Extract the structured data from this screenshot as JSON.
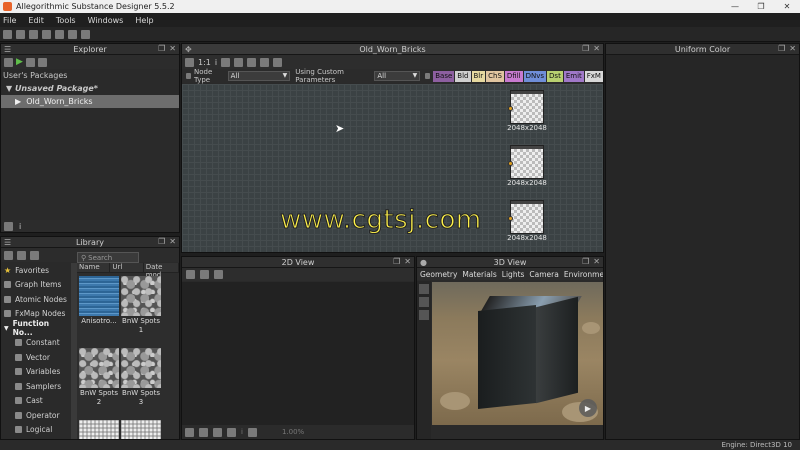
{
  "window": {
    "title": "Allegorithmic Substance Designer 5.5.2",
    "minimize": "—",
    "restore": "❐",
    "close": "✕"
  },
  "menu": [
    "File",
    "Edit",
    "Tools",
    "Windows",
    "Help"
  ],
  "explorer": {
    "title": "Explorer",
    "section": "User's Packages",
    "package": "Unsaved Package*",
    "graph_item": "Old_Worn_Bricks"
  },
  "graph": {
    "title": "Old_Worn_Bricks",
    "zoom_label": "1:1",
    "node_type_label": "Node Type",
    "node_type_value": "All",
    "custom_params_label": "Using Custom Parameters",
    "custom_params_value": "All",
    "tags": [
      {
        "label": "Base",
        "color": "#8d5fa0"
      },
      {
        "label": "Bld",
        "color": "#cfcfcf"
      },
      {
        "label": "Blr",
        "color": "#e6d9a0"
      },
      {
        "label": "ChS",
        "color": "#e0c5a0"
      },
      {
        "label": "Dfill",
        "color": "#c87ad0"
      },
      {
        "label": "DNvs",
        "color": "#6f8ed8"
      },
      {
        "label": "Dst",
        "color": "#b8d070"
      },
      {
        "label": "Emit",
        "color": "#a078c8"
      },
      {
        "label": "FxM",
        "color": "#d8d8d8"
      }
    ],
    "nodes": [
      {
        "label": "2048x2048"
      },
      {
        "label": "2048x2048"
      },
      {
        "label": "2048x2048"
      }
    ],
    "watermark": "www.cgtsj.com"
  },
  "uniform": {
    "title": "Uniform Color"
  },
  "library": {
    "title": "Library",
    "search_placeholder": "Search",
    "columns": [
      "Name",
      "Url",
      "Date mod"
    ],
    "categories": [
      {
        "label": "Favorites",
        "style": "star"
      },
      {
        "label": "Graph Items",
        "style": "normal"
      },
      {
        "label": "Atomic Nodes",
        "style": "normal"
      },
      {
        "label": "FxMap Nodes",
        "style": "normal"
      },
      {
        "label": "Function No...",
        "style": "bold"
      },
      {
        "label": "Constant",
        "style": "sub"
      },
      {
        "label": "Vector",
        "style": "sub"
      },
      {
        "label": "Variables",
        "style": "sub"
      },
      {
        "label": "Samplers",
        "style": "sub"
      },
      {
        "label": "Cast",
        "style": "sub"
      },
      {
        "label": "Operator",
        "style": "sub"
      },
      {
        "label": "Logical",
        "style": "sub"
      }
    ],
    "thumbnails": [
      {
        "label": "Anisotro...",
        "tex": "blue"
      },
      {
        "label": "BnW Spots 1",
        "tex": "spots"
      },
      {
        "label": "BnW Spots 2",
        "tex": "spots"
      },
      {
        "label": "BnW Spots 3",
        "tex": "spots"
      },
      {
        "label": "",
        "tex": "noise"
      },
      {
        "label": "",
        "tex": "noise"
      }
    ]
  },
  "view2d": {
    "title": "2D View",
    "zoom": "1.00%"
  },
  "view3d": {
    "title": "3D View",
    "menu": [
      "Geometry",
      "Materials",
      "Lights",
      "Camera",
      "Environment"
    ]
  },
  "status": {
    "engine": "Engine: Direct3D 10"
  }
}
